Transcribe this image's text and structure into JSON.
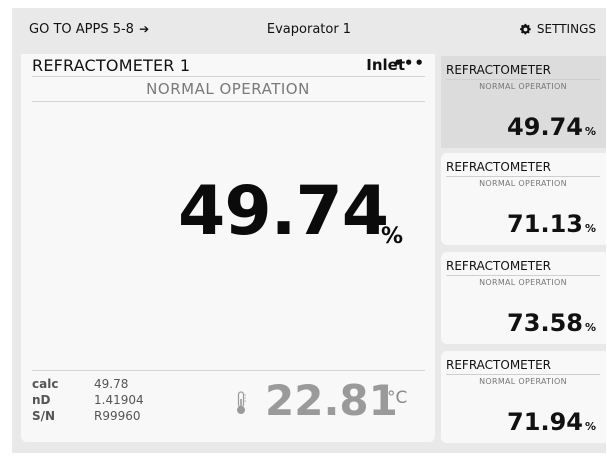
{
  "header": {
    "goto_label": "GO TO APPS 5-8",
    "goto_arrow": "➔",
    "title": "Evaporator 1",
    "settings_label": "SETTINGS"
  },
  "main": {
    "title": "REFRACTOMETER 1",
    "location": "Inlet",
    "more": "•••",
    "status": "NORMAL OPERATION",
    "value": "49.74",
    "unit": "%",
    "diagnostics": [
      {
        "label": "calc",
        "value": "49.78"
      },
      {
        "label": "nD",
        "value": "1.41904"
      },
      {
        "label": "S/N",
        "value": "R99960"
      }
    ],
    "temperature": "22.81",
    "temperature_unit": "°C"
  },
  "cards": [
    {
      "title": "REFRACTOMETER",
      "status": "NORMAL OPERATION",
      "value": "49.74",
      "unit": "%",
      "selected": true
    },
    {
      "title": "REFRACTOMETER",
      "status": "NORMAL OPERATION",
      "value": "71.13",
      "unit": "%",
      "selected": false
    },
    {
      "title": "REFRACTOMETER",
      "status": "NORMAL OPERATION",
      "value": "73.58",
      "unit": "%",
      "selected": false
    },
    {
      "title": "REFRACTOMETER",
      "status": "NORMAL OPERATION",
      "value": "71.94",
      "unit": "%",
      "selected": false
    }
  ],
  "colors": {
    "background": "#e9e9e9",
    "panel": "#f8f8f8",
    "selected_card": "#dcdcdc",
    "temperature_text": "#9a9a9a"
  },
  "icons": [
    "gear-icon",
    "thermometer-icon",
    "arrow-right-icon",
    "more-icon"
  ]
}
